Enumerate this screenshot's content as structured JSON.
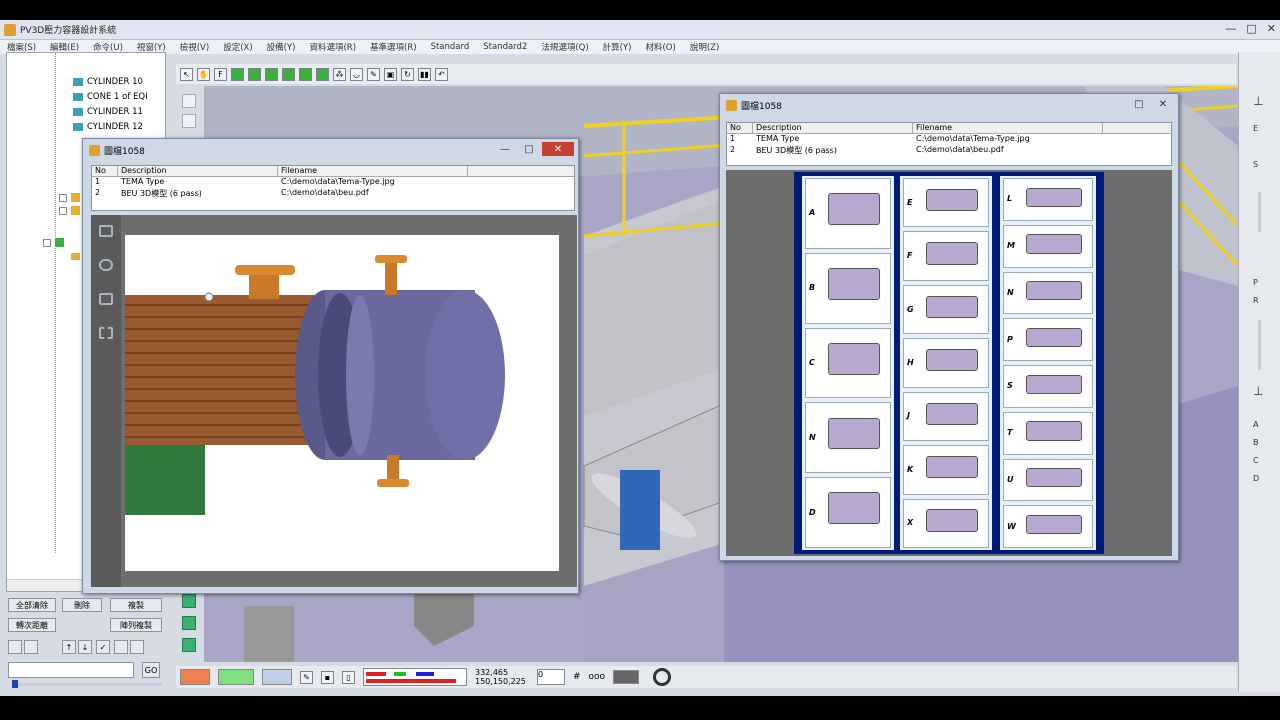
{
  "app": {
    "title": "PV3D壓力容器設計系統",
    "window_controls": [
      "—",
      "□",
      "✕"
    ],
    "menus": [
      "檔案(S)",
      "編輯(E)",
      "命令(U)",
      "視窗(Y)",
      "檢視(V)",
      "設定(X)",
      "設備(Y)",
      "資料選項(R)",
      "基準選項(R)",
      "Standard",
      "Standard2",
      "法規選項(Q)",
      "計算(Y)",
      "材料(O)",
      "說明(Z)"
    ]
  },
  "tree": {
    "items": [
      {
        "label": "CYLINDER 10",
        "icon": "cylinder-icon"
      },
      {
        "label": "CONE 1 of EQI",
        "icon": "cone-icon"
      },
      {
        "label": "CYLINDER 11",
        "icon": "cylinder-icon"
      },
      {
        "label": "CYLINDER 12",
        "icon": "cylinder-icon"
      }
    ],
    "buttons": {
      "clear_all": "全部清除",
      "delete": "刪除",
      "copy": "複製",
      "batch": "轉次距離",
      "batch_copy": "陣列複製",
      "go": "GO"
    }
  },
  "toolbar": {
    "icons": [
      "pointer-icon",
      "hand-icon",
      "f-icon",
      "cube-icon",
      "cube-icon",
      "cube-icon",
      "cube-icon",
      "cube-icon",
      "cube-icon",
      "molecule-icon",
      "cup-icon",
      "pen-icon",
      "camera-icon",
      "refresh-icon",
      "stop-icon",
      "undo-icon"
    ]
  },
  "status": {
    "coords1": "332,465",
    "coords2": "150,150,225",
    "field1": "0",
    "zoom_field": "0"
  },
  "right_strip": {
    "letters": [
      "E",
      "S",
      "P",
      "R",
      "A",
      "B",
      "C",
      "D"
    ]
  },
  "dialog_left": {
    "title": "圖檔1058",
    "columns": [
      "No",
      "Description",
      "Filename"
    ],
    "rows": [
      {
        "no": "1",
        "description": "TEMA Type",
        "filename": "C:\\demo\\data\\Tema-Type.jpg"
      },
      {
        "no": "2",
        "description": "BEU 3D模型 (6 pass)",
        "filename": "C:\\demo\\data\\beu.pdf"
      }
    ]
  },
  "dialog_right": {
    "title": "圖檔1058",
    "columns": [
      "No",
      "Description",
      "Filename"
    ],
    "rows": [
      {
        "no": "1",
        "description": "TEMA Type",
        "filename": "C:\\demo\\data\\Tema-Type.jpg"
      },
      {
        "no": "2",
        "description": "BEU 3D模型 (6 pass)",
        "filename": "C:\\demo\\data\\beu.pdf"
      }
    ],
    "tema_columns": [
      {
        "letters": [
          "A",
          "B",
          "C",
          "N",
          "D"
        ]
      },
      {
        "letters": [
          "E",
          "F",
          "G",
          "H",
          "J",
          "K",
          "X"
        ]
      },
      {
        "letters": [
          "L",
          "M",
          "N",
          "P",
          "S",
          "T",
          "U",
          "W"
        ]
      }
    ]
  },
  "colors": {
    "title_bg": "#dfe6f0",
    "viewport": "#a8a4c8",
    "dialog_bg": "#cfd8e6",
    "tema_border": "#001a7a",
    "tema_cell": "#e6f0ff",
    "close_btn": "#c84030"
  }
}
